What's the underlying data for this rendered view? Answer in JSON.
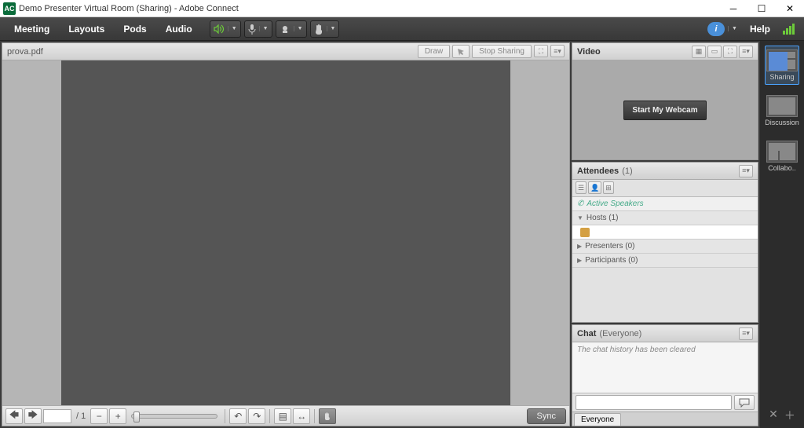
{
  "window": {
    "title": "Demo Presenter Virtual Room (Sharing) - Adobe Connect"
  },
  "menu": {
    "meeting": "Meeting",
    "layouts": "Layouts",
    "pods": "Pods",
    "audio": "Audio",
    "help": "Help"
  },
  "share": {
    "filename": "prova.pdf",
    "draw": "Draw",
    "stop": "Stop Sharing",
    "page_total": "/ 1",
    "sync": "Sync"
  },
  "video": {
    "title": "Video",
    "start": "Start My Webcam"
  },
  "attendees": {
    "title": "Attendees",
    "count": "(1)",
    "active_speakers": "Active Speakers",
    "hosts": "Hosts (1)",
    "presenters": "Presenters (0)",
    "participants": "Participants (0)"
  },
  "chat": {
    "title": "Chat",
    "scope": "(Everyone)",
    "cleared": "The chat history has been cleared",
    "tab": "Everyone"
  },
  "layouts": {
    "sharing": "Sharing",
    "discussion": "Discussion",
    "collab": "Collabo.."
  }
}
